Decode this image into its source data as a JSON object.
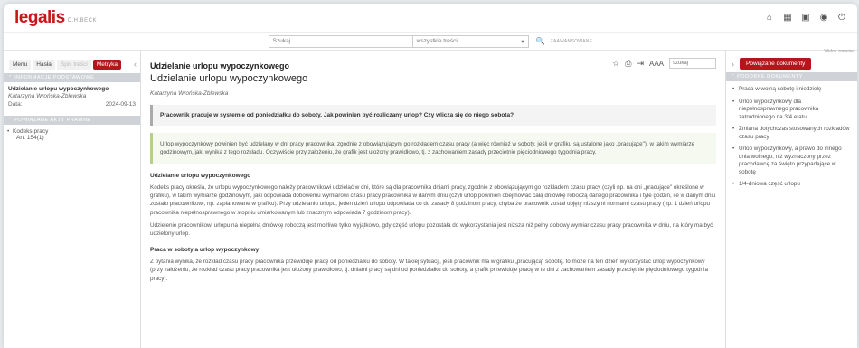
{
  "header": {
    "logo": "legalis",
    "logo_sub": "C.H.BECK",
    "icons": [
      "home-icon",
      "calendar-icon",
      "briefcase-icon",
      "user-icon",
      "power-icon"
    ]
  },
  "search": {
    "placeholder": "Szukaj...",
    "scope": "wszystkie treści",
    "advanced_label": "ZAAWANSOWANE"
  },
  "left_panel": {
    "tabs": [
      "Menu",
      "Hasła",
      "Spis treści",
      "Metryka"
    ],
    "active_tab": "Metryka",
    "section_basic": "INFORMACJE PODSTAWOWE",
    "doc_title": "Udzielanie urlopu wypoczynkowego",
    "doc_author": "Katarzyna Wrońska-Zblewska",
    "date_label": "Data:",
    "date_value": "2024-09-13",
    "section_acts": "POWIĄZANE AKTY PRAWNE",
    "act": "Kodeks pracy",
    "act_article": "Art. 154(1)"
  },
  "main": {
    "title_bold": "Udzielanie urlopu wypoczynkowego",
    "title": "Udzielanie urlopu wypoczynkowego",
    "author": "Katarzyna Wrońska-Zblewska",
    "toolbar_aa": "AAA",
    "toolbar_search_placeholder": "szukaj",
    "question": "Pracownik pracuje w systemie od poniedziałku do soboty. Jak powinien być rozliczany urlop? Czy wlicza się do niego sobota?",
    "answer": "Urlop wypoczynkowy powinien być udzielany w dni pracy pracownika, zgodnie z obowiązującym go rozkładem czasu pracy (a więc również w soboty, jeśli w grafiku są ustalone jako „pracujące\"), w takim wymiarze godzinowym, jaki wynika z tego rozkładu. Oczywiście przy założeniu, że grafik jest ułożony prawidłowo, tj. z zachowaniem zasady przeciętnie pięciodniowego tygodnia pracy.",
    "section1_title": "Udzielanie urlopu wypoczynkowego",
    "section1_p1": "Kodeks pracy określa, że urlopu wypoczynkowego należy pracownikowi udzielać w dni, które są dla pracownika dniami pracy, zgodnie z obowiązującym go rozkładem czasu pracy (czyli np. na dni „pracujące\" określone w grafiku), w takim wymiarze godzinowym, jaki odpowiada dobowemu wymiarowi czasu pracy pracownika w danym dniu (czyli urlop powinien obejmować całą dniówkę roboczą danego pracownika i tyle godzin, ile w danym dniu zostało pracownikowi, np. zaplanowane w grafiku). Przy udzielaniu urlopu, jeden dzień urlopu odpowiada co do zasady 8 godzinom pracy, chyba że pracownik został objęty niższymi normami czasu pracy (np. 1 dzień urlopu pracownika niepełnosprawnego w stopniu umiarkowanym lub znacznym odpowiada 7 godzinom pracy).",
    "section1_p2": "Udzielenie pracownikowi urlopu na niepełną dniówkę roboczą jest możliwe tylko wyjątkowo, gdy część urlopu pozostała do wykorzystania jest niższa niż pełny dobowy wymiar czasu pracy pracownika w dniu, na który ma być udzielony urlop.",
    "section2_title": "Praca w soboty a urlop wypoczynkowy",
    "section2_p1": "Z pytania wynika, że rozkład czasu pracy pracownika przewiduje pracę od poniedziałku do soboty. W takiej sytuacji, jeśli pracownik ma w grafiku „pracującą\" sobotę, to może na ten dzień wykorzystać urlop wypoczynkowy (przy założeniu, że rozkład czasu pracy pracownika jest ułożony prawidłowo, tj. dniami pracy są dni od poniedziałku do soboty, a grafik przewiduje pracę w te dni z zachowaniem zasady przeciętnie pięciodniowego tygodnia pracy)."
  },
  "right_panel": {
    "note": "Widok zmianie",
    "related_button": "Powiązane dokumenty",
    "section": "PODOBNE DOKUMENTY",
    "items": [
      "Praca w wolną sobotę i niedzielę",
      "Urlop wypoczynkowy dla niepełnosprawnego pracownika zatrudnionego na 3/4 etatu",
      "Zmiana dotychczas stosowanych rozkładów czasu pracy",
      "Urlop wypoczynkowy, a prawo do innego dnia wolnego, niż wyznaczony przez pracodawcę za święto przypadające w sobotę",
      "1/4-dniowa część urlopu"
    ]
  }
}
